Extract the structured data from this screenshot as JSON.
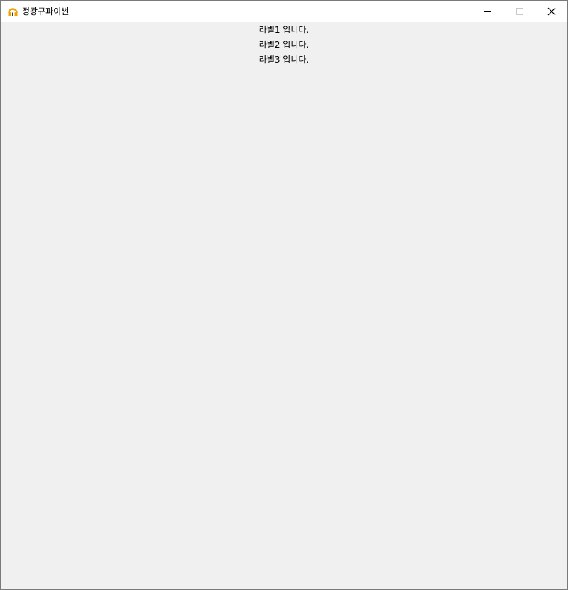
{
  "window": {
    "title": "정광규파이썬",
    "app_icon": "headphones-icon",
    "controls": {
      "minimize_icon": "minimize-icon",
      "maximize_icon": "maximize-icon",
      "close_icon": "close-icon"
    }
  },
  "labels": [
    {
      "text": "라벨1 입니다."
    },
    {
      "text": "라벨2 입니다."
    },
    {
      "text": "라벨3 입니다."
    }
  ],
  "colors": {
    "titlebar_bg": "#ffffff",
    "client_bg": "#f0f0f0",
    "icon_orange": "#f5a000",
    "text": "#000000"
  }
}
